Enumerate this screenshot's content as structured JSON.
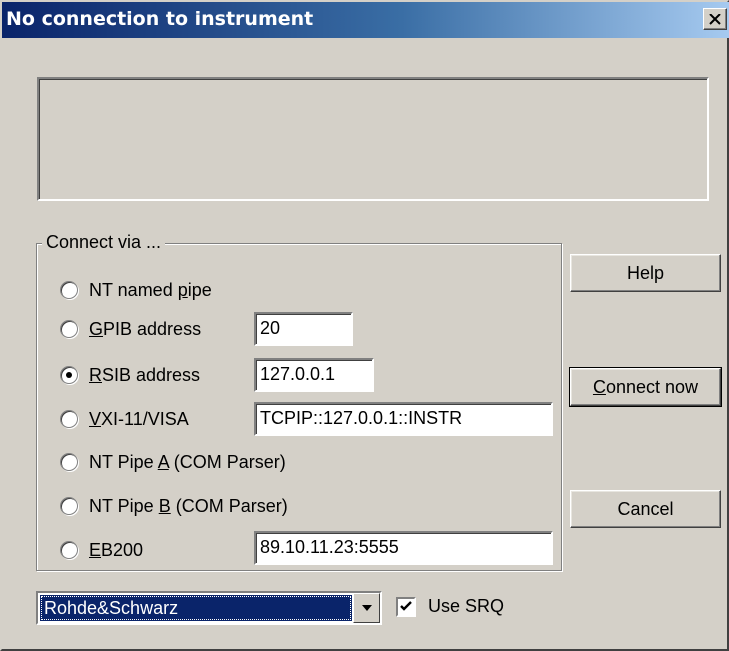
{
  "window": {
    "title": "No connection to instrument"
  },
  "message": "",
  "connect_group": {
    "legend": "Connect via ...",
    "options": [
      {
        "pre": "NT named ",
        "mnemonic": "p",
        "post": "ipe",
        "checked": false
      },
      {
        "pre": "",
        "mnemonic": "G",
        "post": "PIB address",
        "checked": false,
        "value": "20"
      },
      {
        "pre": "",
        "mnemonic": "R",
        "post": "SIB address",
        "checked": true,
        "value": "127.0.0.1"
      },
      {
        "pre": "",
        "mnemonic": "V",
        "post": "XI-11/VISA",
        "checked": false,
        "value": "TCPIP::127.0.0.1::INSTR"
      },
      {
        "pre": "NT Pipe ",
        "mnemonic": "A",
        "post": " (COM Parser)",
        "checked": false
      },
      {
        "pre": "NT Pipe ",
        "mnemonic": "B",
        "post": " (COM Parser)",
        "checked": false
      },
      {
        "pre": "",
        "mnemonic": "E",
        "post": "B200",
        "checked": false,
        "value": "89.10.11.23:5555"
      }
    ]
  },
  "buttons": {
    "help": "Help",
    "connect_mnemonic": "C",
    "connect_rest": "onnect now",
    "cancel": "Cancel"
  },
  "vendor_select": {
    "selected": "Rohde&Schwarz"
  },
  "use_srq": {
    "label": "Use SRQ",
    "checked": true
  },
  "icons": [
    "close-icon",
    "dropdown-arrow-icon",
    "checkmark-icon"
  ]
}
